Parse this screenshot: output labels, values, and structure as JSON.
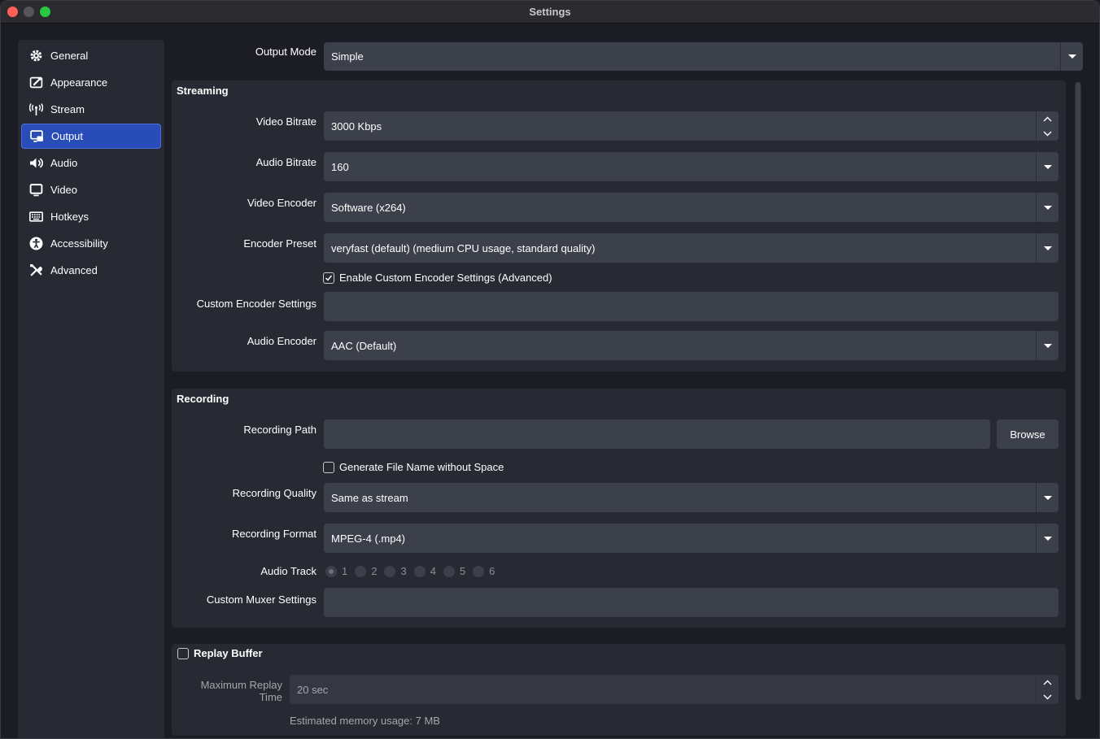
{
  "window": {
    "title": "Settings"
  },
  "sidebar": {
    "items": [
      {
        "label": "General",
        "icon": "gear-icon",
        "active": false
      },
      {
        "label": "Appearance",
        "icon": "appearance-icon",
        "active": false
      },
      {
        "label": "Stream",
        "icon": "antenna-icon",
        "active": false
      },
      {
        "label": "Output",
        "icon": "output-icon",
        "active": true
      },
      {
        "label": "Audio",
        "icon": "speaker-icon",
        "active": false
      },
      {
        "label": "Video",
        "icon": "monitor-icon",
        "active": false
      },
      {
        "label": "Hotkeys",
        "icon": "keyboard-icon",
        "active": false
      },
      {
        "label": "Accessibility",
        "icon": "accessibility-icon",
        "active": false
      },
      {
        "label": "Advanced",
        "icon": "tools-icon",
        "active": false
      }
    ]
  },
  "output_mode": {
    "label": "Output Mode",
    "value": "Simple"
  },
  "streaming": {
    "title": "Streaming",
    "video_bitrate": {
      "label": "Video Bitrate",
      "value": "3000 Kbps"
    },
    "audio_bitrate": {
      "label": "Audio Bitrate",
      "value": "160"
    },
    "video_encoder": {
      "label": "Video Encoder",
      "value": "Software (x264)"
    },
    "encoder_preset": {
      "label": "Encoder Preset",
      "value": "veryfast (default) (medium CPU usage, standard quality)"
    },
    "custom_encoder_checkbox": {
      "label": "Enable Custom Encoder Settings (Advanced)",
      "checked": true
    },
    "custom_encoder_settings": {
      "label": "Custom Encoder Settings",
      "value": ""
    },
    "audio_encoder": {
      "label": "Audio Encoder",
      "value": "AAC (Default)"
    }
  },
  "recording": {
    "title": "Recording",
    "path": {
      "label": "Recording Path",
      "value": "",
      "browse_label": "Browse"
    },
    "no_space_checkbox": {
      "label": "Generate File Name without Space",
      "checked": false
    },
    "quality": {
      "label": "Recording Quality",
      "value": "Same as stream"
    },
    "format": {
      "label": "Recording Format",
      "value": "MPEG-4 (.mp4)"
    },
    "audio_track": {
      "label": "Audio Track",
      "tracks": [
        "1",
        "2",
        "3",
        "4",
        "5",
        "6"
      ],
      "selected": "1"
    },
    "custom_muxer": {
      "label": "Custom Muxer Settings",
      "value": ""
    }
  },
  "replay_buffer": {
    "title": "Replay Buffer",
    "checked": false,
    "max_time": {
      "label": "Maximum Replay Time",
      "value": "20 sec"
    },
    "memory_note": "Estimated memory usage: 7 MB"
  }
}
